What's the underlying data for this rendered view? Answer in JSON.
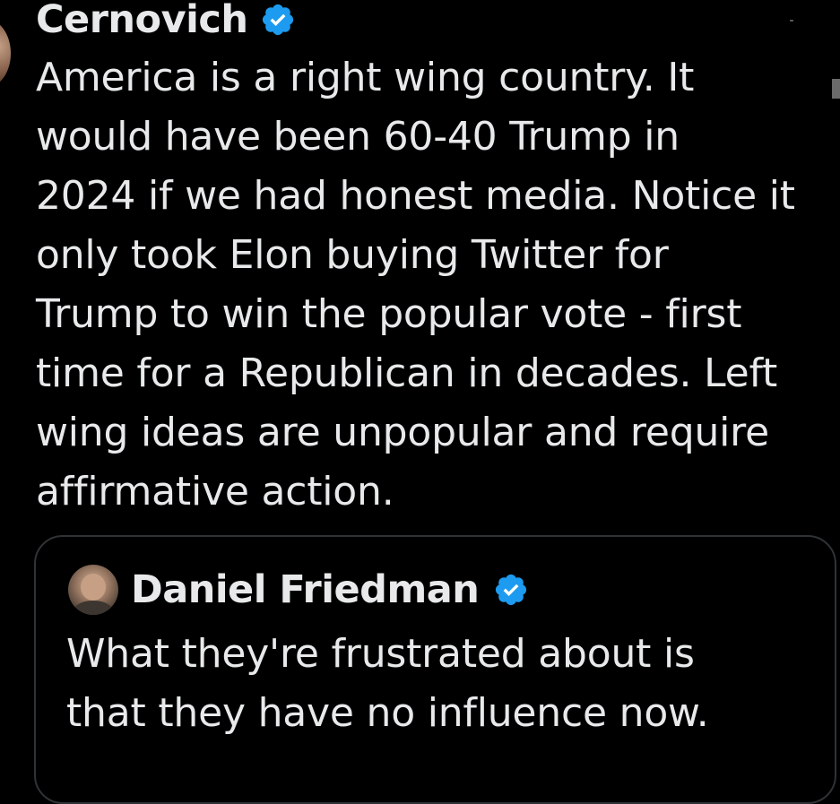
{
  "tweet": {
    "author_name": "Cernovich",
    "text": "America is a right wing country. It\nwould have been 60-40 Trump in\n2024 if we had honest media. Notice it\nonly took Elon buying Twitter for\nTrump to win the popular vote - first\ntime for a Republican in decades. Left\nwing ideas are unpopular and require\naffirmative action."
  },
  "quote": {
    "author_name": "Daniel Friedman",
    "text": "What they're frustrated about is\nthat they have no influence now."
  },
  "icons": {
    "verified": "verified-badge-icon"
  },
  "colors": {
    "background": "#000000",
    "text": "#e7e9ea",
    "verified_blue": "#1d9bf0",
    "card_border": "#2f3336"
  }
}
